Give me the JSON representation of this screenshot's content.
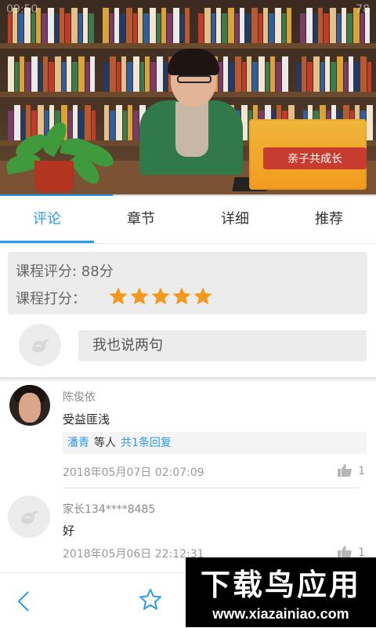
{
  "status_bar": {
    "time": "09:50",
    "battery": "78"
  },
  "video": {
    "sign_text": "亲子共成长",
    "progress": 0.3
  },
  "tabs": [
    {
      "label": "评论",
      "active": true
    },
    {
      "label": "章节",
      "active": false
    },
    {
      "label": "详细",
      "active": false
    },
    {
      "label": "推荐",
      "active": false
    }
  ],
  "rating": {
    "score_text": "课程评分: 88分",
    "rate_label": "课程打分：",
    "stars": 5,
    "star_color": "#f39a1e"
  },
  "comment_input": {
    "placeholder": "我也说两句"
  },
  "comments": [
    {
      "author": "陈俊依",
      "text": "受益匪浅",
      "reply_user": "潘青",
      "reply_mid": "等人",
      "reply_count": "共1条回复",
      "time": "2018年05月07日 02:07:09",
      "likes": "1"
    },
    {
      "author": "家长134****8485",
      "text": "好",
      "time": "2018年05月06日 22:12:31",
      "likes": "1"
    }
  ],
  "watermark": {
    "title": "下载鸟应用",
    "url": "www.xiazainiao.com"
  },
  "colors": {
    "accent": "#2a9af2",
    "input_bg": "#ececec"
  }
}
